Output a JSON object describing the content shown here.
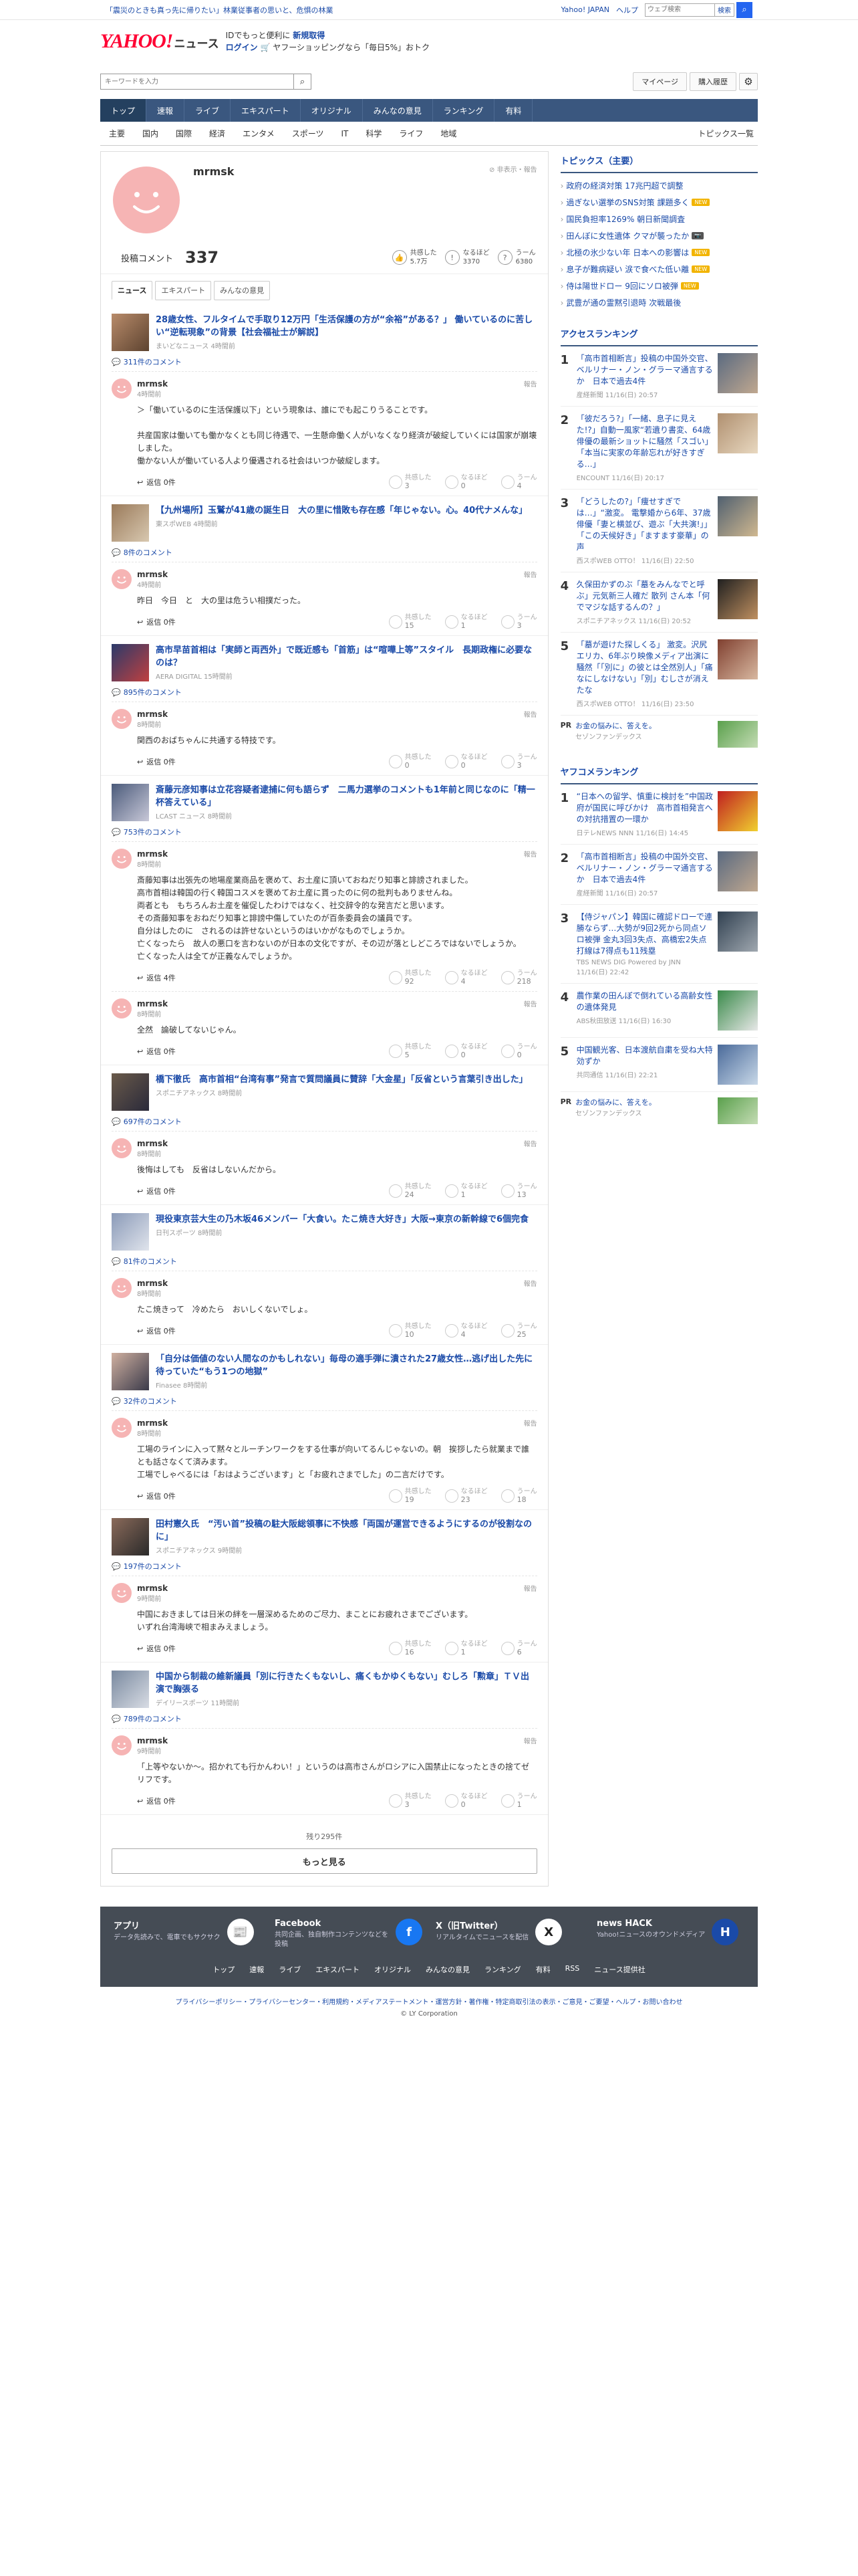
{
  "topbar": {
    "notice": "「震災のときも真っ先に帰りたい」林業従事者の思いと、危惧の林業",
    "links": [
      "Yahoo! JAPAN",
      "ヘルプ"
    ],
    "search_placeholder": "ウェブ検索",
    "search_button": "検索"
  },
  "header": {
    "logo": "YAHOO!",
    "logo_sub": "ニュース",
    "promo1": "IDでもっと便利に",
    "promo1_b": "新規取得",
    "promo2_b": "ログイン",
    "promo2": "ヤフーショッピングなら「毎日5%」おトク"
  },
  "search": {
    "placeholder": "キーワードを入力",
    "account": "マイページ",
    "history": "購入履歴"
  },
  "nav1": [
    "トップ",
    "速報",
    "ライブ",
    "エキスパート",
    "オリジナル",
    "みんなの意見",
    "ランキング",
    "有料"
  ],
  "nav2": [
    "主要",
    "国内",
    "国際",
    "経済",
    "エンタメ",
    "スポーツ",
    "IT",
    "科学",
    "ライフ",
    "地域"
  ],
  "nav2_right": "トピックス一覧",
  "profile": {
    "name": "mrmsk",
    "help": "非表示・報告",
    "comments_label": "投稿コメント",
    "comments": "337",
    "reacts": [
      {
        "icon": "👍",
        "label": "共感した",
        "value": "5.7万"
      },
      {
        "icon": "!",
        "label": "なるほど",
        "value": "3370"
      },
      {
        "icon": "?",
        "label": "うーん",
        "value": "6380"
      }
    ]
  },
  "tabs": [
    "ニュース",
    "エキスパート",
    "みんなの意見"
  ],
  "vote_labels": [
    "共感した",
    "なるほど",
    "うーん"
  ],
  "reply_label": "返信 0件",
  "report_label": "報告",
  "items": [
    {
      "title": "28歳女性、フルタイムで手取り12万円「生活保護の方が“余裕”がある？」 働いているのに苦しい“逆転現象”の背景【社会福祉士が解説】",
      "src": "まいどなニュース 4時間前",
      "count": "311件のコメント",
      "comments": [
        {
          "name": "mrmsk",
          "time": "4時間前",
          "text": "＞「働いているのに生活保護以下」という現象は、誰にでも起こりうることです。\n\n共産国家は働いても働かなくとも同じ待遇で、一生懸命働く人がいなくなり経済が破綻していくには国家が崩壊しました。\n働かない人が働いている人より優遇される社会はいつか破綻します。",
          "reply": "返信 0件",
          "v": [
            "3",
            "0",
            "4"
          ]
        }
      ]
    },
    {
      "title": "【九州場所】玉鷲が41歳の誕生日　大の里に惜敗も存在感「年じゃない。心。40代ナメんな」",
      "src": "東スポWEB 4時間前",
      "count": "8件のコメント",
      "comments": [
        {
          "name": "mrmsk",
          "time": "4時間前",
          "text": "昨日　今日　と　大の里は危うい相撲だった。",
          "reply": "返信 0件",
          "v": [
            "15",
            "1",
            "3"
          ]
        }
      ]
    },
    {
      "title": "高市早苗首相は「実師と両西外」で既近感も「首筋」は“喧嘩上等”スタイル　長期政権に必要なのは？",
      "src": "AERA DIGITAL 15時間前",
      "count": "895件のコメント",
      "comments": [
        {
          "name": "mrmsk",
          "time": "8時間前",
          "text": "関西のおばちゃんに共通する特技です。",
          "reply": "返信 0件",
          "v": [
            "0",
            "0",
            "3"
          ]
        }
      ]
    },
    {
      "title": "斎藤元彦知事は立花容疑者逮捕に何も語らず　二馬力選挙のコメントも1年前と同じなのに「精一杯答えている」",
      "src": "LCAST ニュース 8時間前",
      "count": "753件のコメント",
      "comments": [
        {
          "name": "mrmsk",
          "time": "8時間前",
          "text": "斎藤知事は出張先の地場産業商品を褒めて、お土産に頂いておねだり知事と誹謗されました。\n高市首相は韓国の行く韓国コスメを褒めてお土産に貰ったのに何の批判もありませんね。\n両者とも　もちろんお土産を催促したわけではなく、社交辞令的な発言だと思います。\nその斎藤知事をおねだり知事と誹謗中傷していたのが百条委員会の議員です。\n自分はしたのに　されるのは許せないというのはいかがなものでしょうか。\n亡くなったら　故人の悪口を言わないのが日本の文化ですが、その辺が落としどころではないでしょうか。\n亡くなった人は全てが正義なんでしょうか。",
          "reply": "返信 4件",
          "v": [
            "92",
            "4",
            "218"
          ]
        },
        {
          "name": "mrmsk",
          "time": "8時間前",
          "text": "全然　論破してないじゃん。",
          "reply": "返信 0件",
          "v": [
            "5",
            "0",
            "0"
          ]
        }
      ]
    },
    {
      "title": "橋下徹氏　高市首相“台湾有事”発言で質問議員に賛辞「大金星」「反省という言葉引き出した」",
      "src": "スポニチアネックス 8時間前",
      "count": "697件のコメント",
      "comments": [
        {
          "name": "mrmsk",
          "time": "8時間前",
          "text": "後悔はしても　反省はしないんだから。",
          "reply": "返信 0件",
          "v": [
            "24",
            "1",
            "13"
          ]
        }
      ]
    },
    {
      "title": "現役東京芸大生の乃木坂46メンバー「大食い。たこ焼き大好き」大阪→東京の新幹線で6個完食",
      "src": "日刊スポーツ 8時間前",
      "count": "81件のコメント",
      "comments": [
        {
          "name": "mrmsk",
          "time": "8時間前",
          "text": "たこ焼きって　冷めたら　おいしくないでしょ。",
          "reply": "返信 0件",
          "v": [
            "10",
            "4",
            "25"
          ]
        }
      ]
    },
    {
      "title": "「自分は価値のない人間なのかもしれない」毎母の適手弾に潰された27歳女性…逃げ出した先に待っていた“もう1つの地獄”",
      "src": "Finasee 8時間前",
      "count": "32件のコメント",
      "comments": [
        {
          "name": "mrmsk",
          "time": "8時間前",
          "text": "工場のラインに入って黙々とルーチンワークをする仕事が向いてるんじゃないの。朝　挨拶したら就業まで誰とも話さなくて済みます。\n工場でしゃべるには「おはようございます」と「お疲れさまでした」の二言だけです。",
          "reply": "返信 0件",
          "v": [
            "19",
            "23",
            "18"
          ]
        }
      ]
    },
    {
      "title": "田村憲久氏　“汚い首”投稿の駐大阪総領事に不快感「両国が運営できるようにするのが役割なのに」",
      "src": "スポニチアネックス 9時間前",
      "count": "197件のコメント",
      "comments": [
        {
          "name": "mrmsk",
          "time": "9時間前",
          "text": "中国におきましては日米の絆を一層深めるためのご尽力、まことにお疲れさまでございます。\nいずれ台湾海峡で相まみえましょう。",
          "reply": "返信 0件",
          "v": [
            "16",
            "1",
            "6"
          ]
        }
      ]
    },
    {
      "title": "中国から制裁の維新議員「別に行きたくもないし、痛くもかゆくもない」むしろ「勲章」ＴＶ出演で胸張る",
      "src": "デイリースポーツ 11時間前",
      "count": "789件のコメント",
      "comments": [
        {
          "name": "mrmsk",
          "time": "9時間前",
          "text": "「上等やないか〜。招かれても行かんわい！」というのは高市さんがロシアに入国禁止になったときの捨てゼリフです。",
          "reply": "返信 0件",
          "v": [
            "3",
            "0",
            "1"
          ]
        }
      ]
    }
  ],
  "more": {
    "remaining": "残り295件",
    "button": "もっと見る"
  },
  "side": {
    "topics_title": "トピックス（主要）",
    "topics": [
      {
        "t": "政府の経済対策 17兆円超で調整",
        "b": ""
      },
      {
        "t": "過ぎない選挙のSNS対策 課題多く",
        "b": "NEW"
      },
      {
        "t": "国民負担率1269% 朝日新聞調査",
        "b": ""
      },
      {
        "t": "田んぼに女性遺体 クマが襲ったか",
        "b": "📷"
      },
      {
        "t": "北極の氷少ない年 日本への影響は",
        "b": "NEW"
      },
      {
        "t": "息子が難病疑い 涙で食べた低い離",
        "b": "NEW"
      },
      {
        "t": "侍は陽世ドロー 9回にソロ被弾",
        "b": "NEW"
      },
      {
        "t": "武豊が通の霊黙引退時 次戦最後",
        "b": ""
      }
    ],
    "access_title": "アクセスランキング",
    "access": [
      {
        "t": "「高市首相断言」投稿の中国外交官、ベルリナー・ノン・グラーマ通言するか　日本で過去4件",
        "s": "産経新聞 11/16(日) 20:57"
      },
      {
        "t": "「彼だろう?」「一緒、息子に見えた!?」自動一風家“若遺り書変、64歳俳優の最新ショットに騒然「スゴい」「本当に実家の年齢忘れが好きすぎる…」",
        "s": "ENCOUNT 11/16(日) 20:17"
      },
      {
        "t": "「どうしたの?」「痩せすぎでは…」“激変。 電撃婚から6年、37歳俳優「妻と横並び、遊ぶ「大共演!」」「この天候好き」「ますます豪華」の声",
        "s": "西スポWEB OTTO！ 11/16(日) 22:50"
      },
      {
        "t": "久保田かずのぶ「墓をみんなでと呼ぶ」元気新三人確だ 散列 さん本「何でマジな話するんの？」",
        "s": "スポニチアネックス 11/16(日) 20:52"
      },
      {
        "t": "「墓が遊けた探しくる」 激変。沢尻エリカ、6年ぶり映像メディア出演に騒然「「別に」の彼とは全然別人」「痛なにしなけない」「別」むしさが消えたな",
        "s": "西スポWEB OTTO！ 11/16(日) 23:50"
      }
    ],
    "pr": {
      "tag": "PR",
      "t": "お金の悩みに、答えを。",
      "s": "セゾンファンデックス"
    },
    "yafoo_title": "ヤフコメランキング",
    "yafoo": [
      {
        "t": "“日本への留学、慎重に検討を”中国政府が国民に呼びかけ　高市首相発言への対抗措置の一環か",
        "s": "日テレNEWS NNN 11/16(日) 14:45"
      },
      {
        "t": "「高市首相断言」投稿の中国外交官、ベルリナー・ノン・グラーマ通言するか　日本で過去4件",
        "s": "産経新聞 11/16(日) 20:57"
      },
      {
        "t": "【侍ジャパン】韓国に確認ドローで連勝ならず…大勢が9回2死から同点ソロ被弾 金丸3回3失点、高橋宏2失点 打線は7得点も11残塁",
        "s": "TBS NEWS DIG Powered by JNN 11/16(日) 22:42"
      },
      {
        "t": "農作業の田んぼで倒れている高齢女性の遺体発見",
        "s": "ABS秋田放送 11/16(日) 16:30"
      },
      {
        "t": "中国観光客、日本渡航自粛を受ね大特効ずか",
        "s": "共同通信 11/16(日) 22:21"
      }
    ],
    "pr2": {
      "tag": "PR",
      "t": "お金の悩みに、答えを。",
      "s": "セゾンファンデックス"
    }
  },
  "footer": {
    "apps": [
      {
        "t": "アプリ",
        "d": "データ先読みで、電車でもサクサク",
        "i": "📰"
      },
      {
        "t": "Facebook",
        "d": "共同企画、独自制作コンテンツなどを投稿",
        "i": "f"
      },
      {
        "t": "X（旧Twitter）",
        "d": "リアルタイムでニュースを配信",
        "i": "X"
      },
      {
        "t": "news HACK",
        "d": "Yahoo!ニュースのオウンドメディア",
        "i": "H"
      }
    ],
    "nav": [
      "トップ",
      "速報",
      "ライブ",
      "エキスパート",
      "オリジナル",
      "みんなの意見",
      "ランキング",
      "有料",
      "RSS",
      "ニュース提供社"
    ],
    "links": "プライバシーポリシー・プライバシーセンター・利用規約・メディアステートメント・運営方針・著作権・特定商取引法の表示・ご意見・ご要望・ヘルプ・お問い合わせ",
    "copy": "© LY Corporation"
  },
  "colors": {
    "brand": "#ff0033",
    "nav": "#3a577f",
    "link": "#1a4aa8",
    "avatar": "#f6b4b4"
  }
}
